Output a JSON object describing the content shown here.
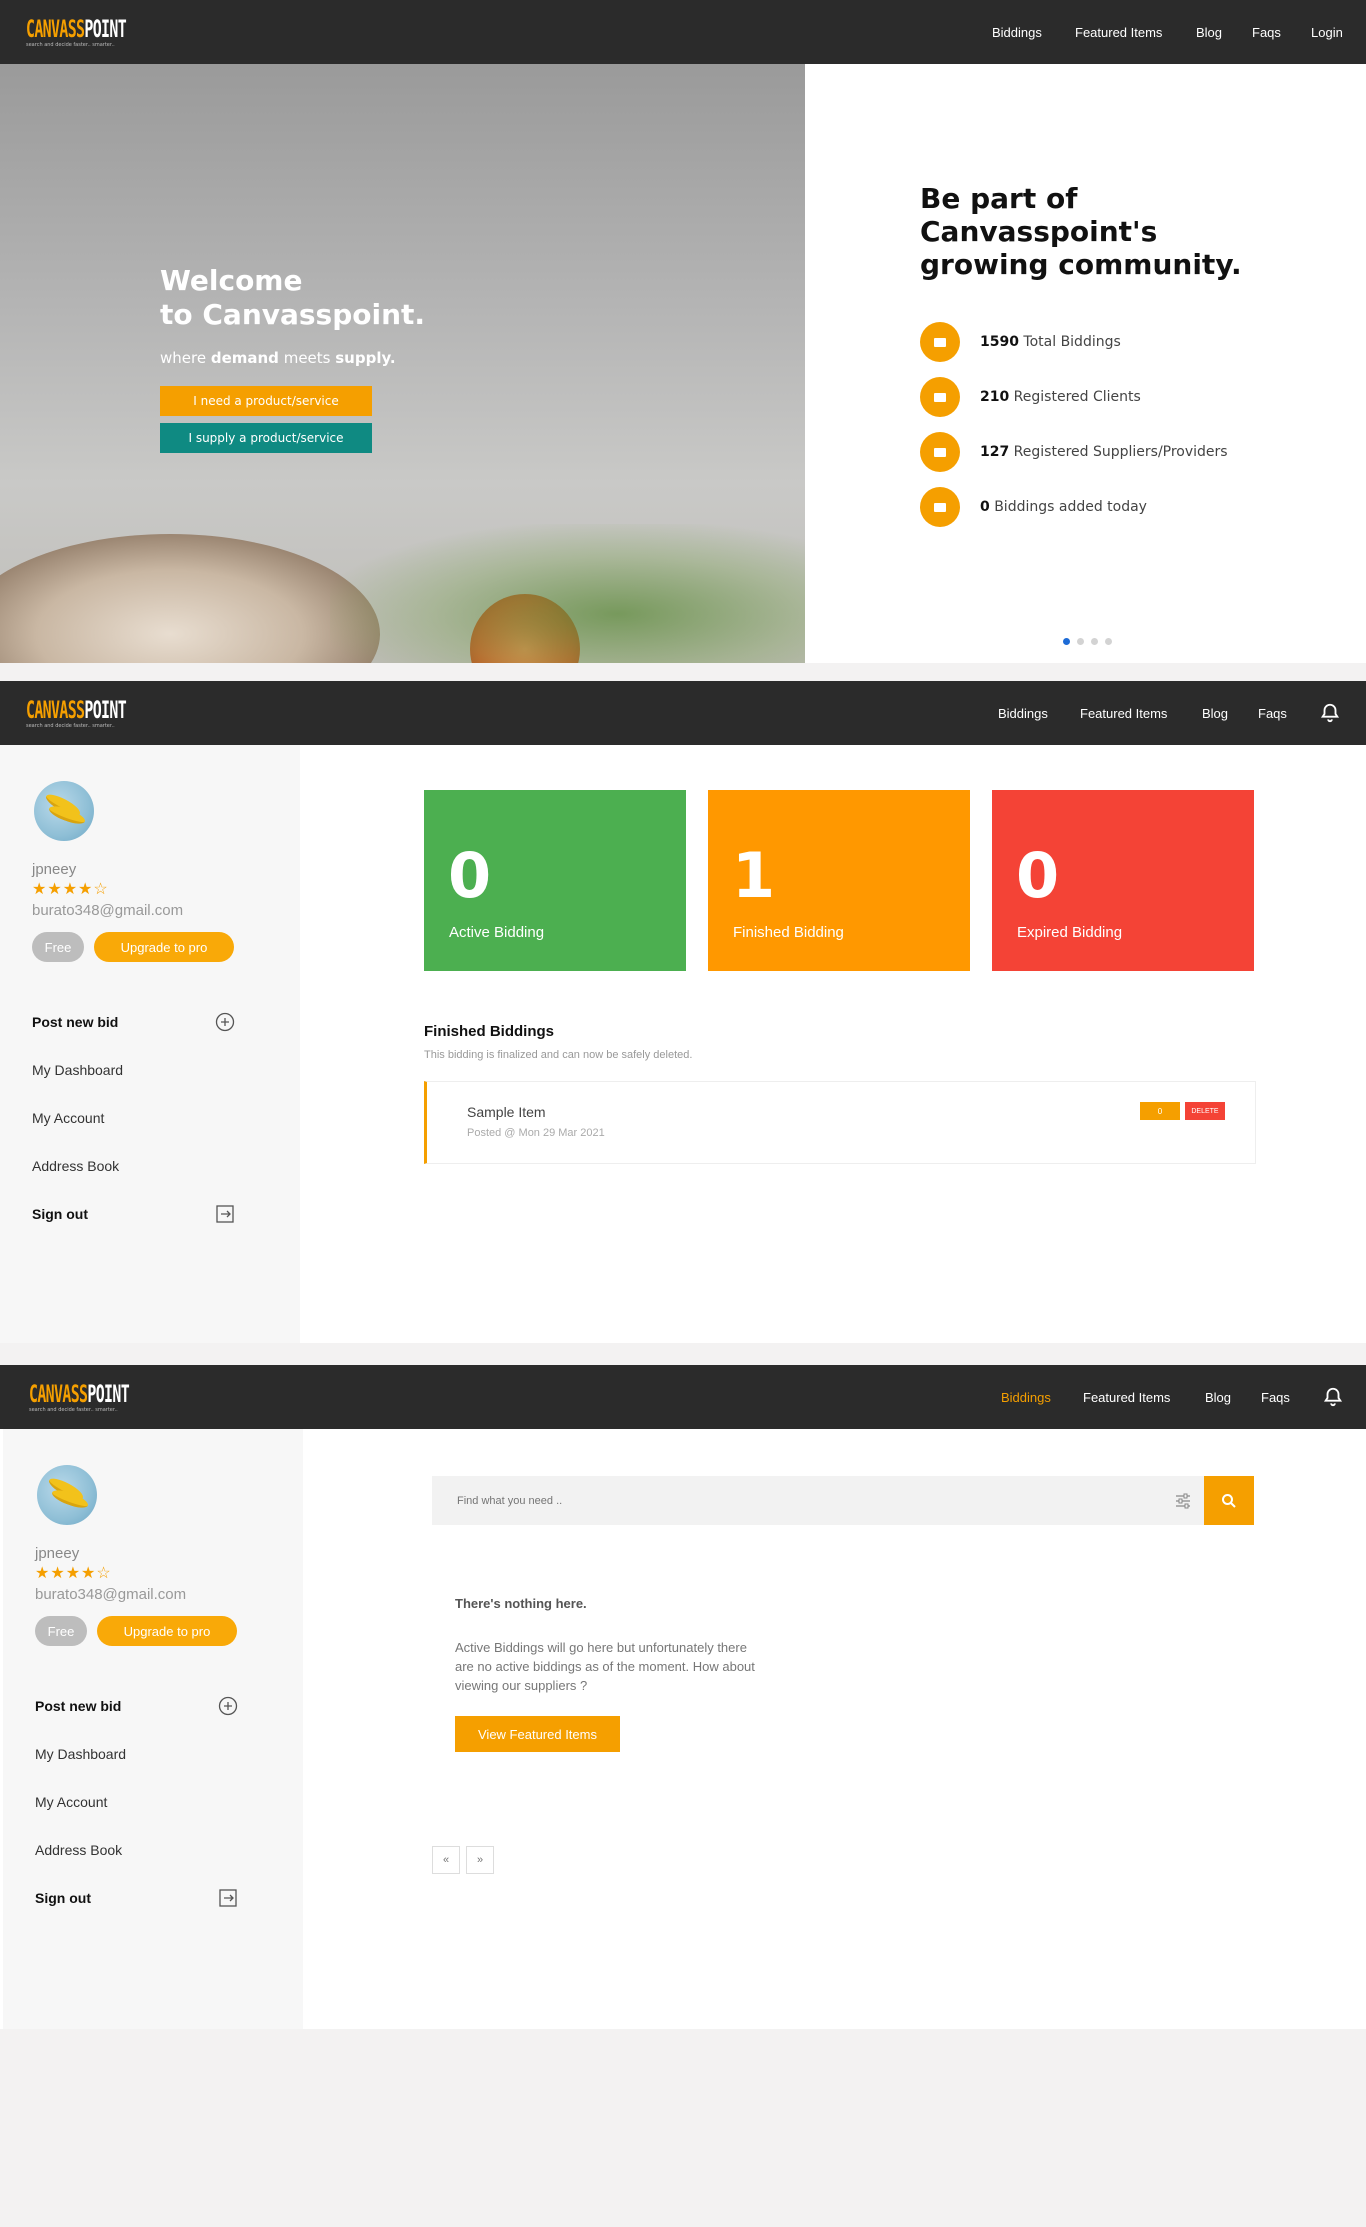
{
  "logo": {
    "word_a": "CANVASS",
    "word_b": "POINT",
    "tagline": "search and decide faster.. smarter.."
  },
  "nav_guest": {
    "biddings": "Biddings",
    "featured": "Featured Items",
    "blog": "Blog",
    "faqs": "Faqs",
    "login": "Login"
  },
  "nav_user": {
    "biddings": "Biddings",
    "featured": "Featured Items",
    "blog": "Blog",
    "faqs": "Faqs"
  },
  "hero": {
    "title_line1": "Welcome",
    "title_line2": "to Canvasspoint.",
    "sub_prefix": "where ",
    "sub_demand": "demand",
    "sub_mid": " meets ",
    "sub_supply": "supply.",
    "btn_need": "I need a product/service",
    "btn_supply": "I supply a product/service"
  },
  "community": {
    "title_line1": "Be part of",
    "title_line2": "Canvasspoint's",
    "title_line3": "growing community.",
    "stats": [
      {
        "num": "1590",
        "label": " Total Biddings"
      },
      {
        "num": "210",
        "label": " Registered Clients"
      },
      {
        "num": "127",
        "label": " Registered Suppliers/Providers"
      },
      {
        "num": "0",
        "label": " Biddings added today"
      }
    ]
  },
  "profile": {
    "username": "jpneey",
    "stars": "★★★★☆",
    "email": "burato348@gmail.com",
    "plan": "Free",
    "upgrade": "Upgrade to pro"
  },
  "sidebar_menu": {
    "post": "Post new bid",
    "dashboard": "My Dashboard",
    "account": "My Account",
    "address": "Address Book",
    "signout": "Sign out"
  },
  "dashboard": {
    "cards": [
      {
        "num": "0",
        "label": "Active Bidding",
        "color": "#4caf50"
      },
      {
        "num": "1",
        "label": "Finished Bidding",
        "color": "#ff9800"
      },
      {
        "num": "0",
        "label": "Expired Bidding",
        "color": "#f44336"
      }
    ],
    "finished_title": "Finished Biddings",
    "finished_note": "This bidding is finalized and can now be safely deleted.",
    "item": {
      "name": "Sample Item",
      "posted": "Posted @ Mon 29 Mar 2021",
      "count": "0",
      "delete": "DELETE"
    }
  },
  "biddings_page": {
    "search_placeholder": "Find what you need ..",
    "empty_title": "There's nothing here.",
    "empty_line1": "Active Biddings will go here but unfortunately there",
    "empty_line2": "are no active biddings as of the moment. How about",
    "empty_line3": "viewing our suppliers ?",
    "cta": "View Featured Items",
    "prev": "«",
    "next": "»"
  },
  "colors": {
    "accent": "#f59f00",
    "topbar": "#2b2b2b",
    "teal": "#0f8a82"
  }
}
